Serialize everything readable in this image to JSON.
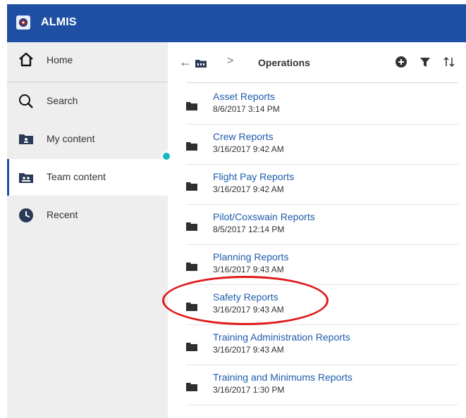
{
  "app": {
    "title": "ALMIS"
  },
  "sidebar": {
    "items": [
      {
        "label": "Home",
        "icon": "home-icon"
      },
      {
        "label": "Search",
        "icon": "search-icon"
      },
      {
        "label": "My content",
        "icon": "user-folder-icon"
      },
      {
        "label": "Team content",
        "icon": "team-folder-icon",
        "active": true
      },
      {
        "label": "Recent",
        "icon": "clock-icon"
      }
    ]
  },
  "toolbar": {
    "back_icon": "back-arrow-icon",
    "breadcrumb_separator": ">",
    "current_folder": "Operations",
    "actions": [
      "add-icon",
      "filter-icon",
      "sort-icon"
    ]
  },
  "files": [
    {
      "name": "Asset Reports",
      "date": "8/6/2017 3:14 PM"
    },
    {
      "name": "Crew Reports",
      "date": "3/16/2017 9:42 AM"
    },
    {
      "name": "Flight Pay Reports",
      "date": "3/16/2017 9:42 AM"
    },
    {
      "name": "Pilot/Coxswain Reports",
      "date": "8/5/2017 12:14 PM"
    },
    {
      "name": "Planning Reports",
      "date": "3/16/2017 9:43 AM"
    },
    {
      "name": "Safety Reports",
      "date": "3/16/2017 9:43 AM",
      "highlighted": true
    },
    {
      "name": "Training Administration Reports",
      "date": "3/16/2017 9:43 AM"
    },
    {
      "name": "Training and Minimums Reports",
      "date": "3/16/2017 1:30 PM"
    }
  ],
  "colors": {
    "header": "#1e4fa3",
    "link": "#1e5cab",
    "highlight": "#e01a1a",
    "indicator": "#14b8c2"
  }
}
